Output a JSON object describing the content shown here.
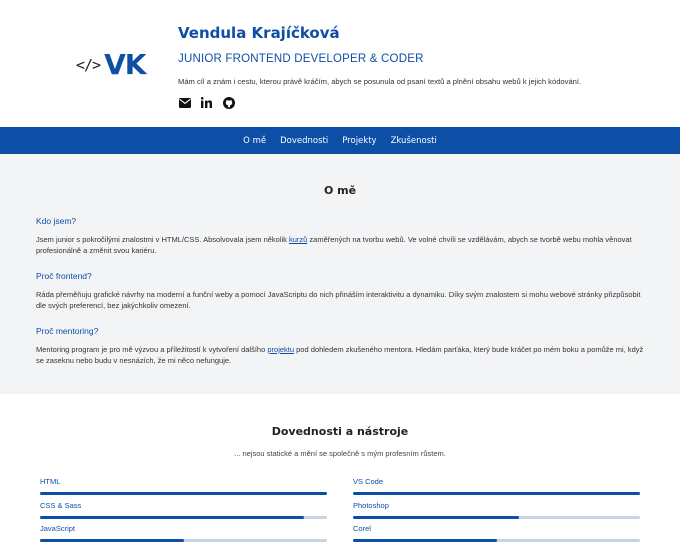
{
  "logo": {
    "code": "</>",
    "initials": "VK"
  },
  "profile": {
    "name": "Vendula Krajíčková",
    "role": "JUNIOR FRONTEND DEVELOPER & CODER",
    "intro": "Mám cíl a znám i cestu, kterou právě kráčím, abych se posunula od psaní textů a plnění obsahu webů k jejich kódování."
  },
  "social": [
    "envelope-icon",
    "linkedin-icon",
    "github-icon"
  ],
  "nav": [
    "O mě",
    "Dovednosti",
    "Projekty",
    "Zkušenosti"
  ],
  "about": {
    "title": "O mě",
    "q1": "Kdo jsem?",
    "p1_a": "Jsem junior s pokročilými znalostmi v HTML/CSS. Absolvovala jsem několik ",
    "p1_link": "kurzů",
    "p1_b": " zaměřených na tvorbu webů. Ve volné chvíli se vzdělávám, abych se tvorbě webu mohla věnovat profesionálně a změnit svou kariéru.",
    "q2": "Proč frontend?",
    "p2": "Ráda přeměňuju grafické návrhy na moderní a funční weby a pomocí JavaScriptu do nich přináším interaktivitu a dynamiku. Díky svým znalostem si mohu webové stránky přizpůsobit dle svých preferencí, bez jakýchkoliv omezení.",
    "q3": "Proč mentoring?",
    "p3_a": "Mentoring program je pro mě výzvou a příležitostí k vytvoření dalšího ",
    "p3_link": "projektu",
    "p3_b": " pod dohledem zkušeného mentora. Hledám parťáka, který bude kráčet po mém boku a pomůže mi, když se zaseknu nebo budu v nesnázích, že mi něco nefunguje."
  },
  "skills": {
    "title": "Dovednosti a nástroje",
    "subtitle": "... nejsou statické a mění se společně s mým profesním růstem.",
    "items": [
      {
        "label": "HTML",
        "level": 1.0
      },
      {
        "label": "VS Code",
        "level": 1.0
      },
      {
        "label": "CSS & Sass",
        "level": 0.92
      },
      {
        "label": "Photoshop",
        "level": 0.58
      },
      {
        "label": "JavaScript",
        "level": 0.5
      },
      {
        "label": "Corel",
        "level": 0.5
      }
    ]
  },
  "colors": {
    "accent": "#0d4ea6",
    "about_bg": "#f3f4f6"
  }
}
